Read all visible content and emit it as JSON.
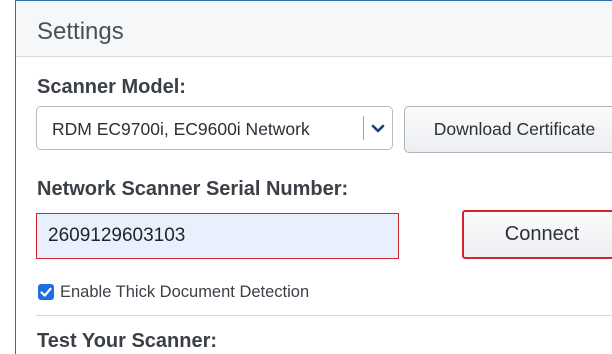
{
  "panel": {
    "title": "Settings"
  },
  "scanner_model": {
    "label": "Scanner Model:",
    "selected": "RDM EC9700i, EC9600i Network",
    "download_label": "Download Certificate"
  },
  "serial": {
    "label": "Network Scanner Serial Number:",
    "value": "2609129603103",
    "connect_label": "Connect"
  },
  "thick_detection": {
    "label": "Enable Thick Document Detection",
    "checked": true
  },
  "test": {
    "label": "Test Your Scanner:"
  },
  "colors": {
    "frame": "#2f6db5",
    "highlight": "#d0262b",
    "checkbox": "#1c6fe0",
    "input_bg": "#e9f0fd"
  },
  "icons": {
    "select_arrow": "chevron-down-icon",
    "checkbox_mark": "checkmark-icon"
  }
}
